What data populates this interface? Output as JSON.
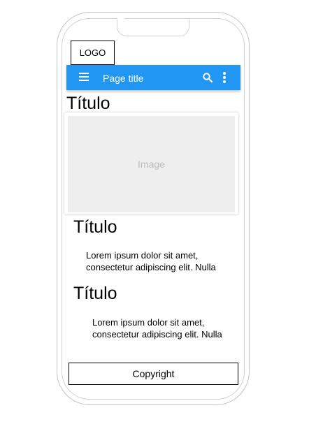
{
  "header": {
    "logo_text": "LOGO"
  },
  "appbar": {
    "title": "Page title",
    "icons": {
      "menu": "hamburger-menu-icon",
      "search": "search-icon",
      "more": "more-vertical-icon"
    },
    "color": "#2196f3"
  },
  "sections": [
    {
      "title": "Título"
    },
    {
      "title": "Título",
      "text": "Lorem ipsum dolor sit amet, consectetur adipiscing elit. Nulla"
    },
    {
      "title": "Título",
      "text": "Lorem ipsum dolor sit amet, consectetur adipiscing elit. Nulla"
    }
  ],
  "image": {
    "placeholder": "Image"
  },
  "footer": {
    "copyright": "Copyright"
  }
}
